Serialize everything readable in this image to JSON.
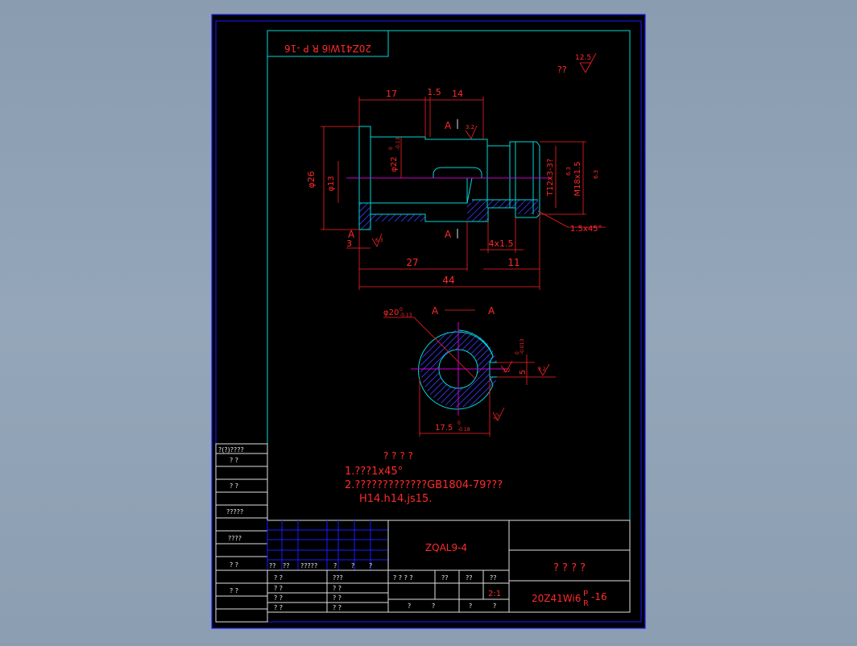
{
  "drawing": {
    "part_code_rotated": "20Z41Wi6 R P -16",
    "roughness_note": {
      "marks": "??",
      "value": "12.5"
    },
    "dims": {
      "d17": "17",
      "d1_5": "1.5",
      "d14": "14",
      "phi26": "φ26",
      "phi13": "φ13",
      "phi22": "φ22",
      "phi22_tol_up": "0",
      "phi22_tol_low": "-0.13",
      "thread_tr": "T12x3-3?",
      "thread_m": "M18x1.5",
      "d3": "3",
      "d27": "27",
      "d44": "44",
      "d4x1_5": "4x1.5",
      "d11": "11",
      "chamfer": "1.5x45°",
      "rough_32": "3.2",
      "rough_63": "6.3"
    },
    "section_mark": "A",
    "section_title_left": "A",
    "section_title_right": "A",
    "section_dims": {
      "phi20": "φ20",
      "phi20_up": "0",
      "phi20_low": "-0.13",
      "w5": "5",
      "w5_up": "0",
      "w5_low": "-0.013",
      "d17_5": "17.5",
      "d17_5_up": "0",
      "d17_5_low": "-0.18",
      "rough_32": "3.2"
    },
    "notes": {
      "title": "? ? ? ?",
      "line1": "1.???1x45°",
      "line2": "2.?????????????GB1804-79???",
      "line3": "H14.h14.js15."
    }
  },
  "side_table": {
    "rows": [
      "?(?)????",
      "?   ?",
      "?   ?",
      "?????",
      "????",
      "?   ?",
      "?   ?"
    ]
  },
  "title_block": {
    "header_cells": [
      "??",
      "??",
      "?????",
      "?",
      "?",
      "?"
    ],
    "sig_left": [
      "? ?",
      "? ?",
      "? ?",
      "? ?"
    ],
    "sig_mid": [
      "???",
      "? ?",
      "? ?",
      "? ?"
    ],
    "material": "ZQAL9-4",
    "part_name": "? ? ? ?",
    "stage_labels": [
      "? ? ? ?",
      "??",
      "??",
      "??"
    ],
    "scale": "2:1",
    "sheet_labels": [
      "?",
      "?",
      "?",
      "?"
    ],
    "drawing_number": "20Z41Wi6",
    "drawing_number_sup": "P",
    "drawing_number_sub": "R",
    "drawing_number_suffix": "-16"
  }
}
